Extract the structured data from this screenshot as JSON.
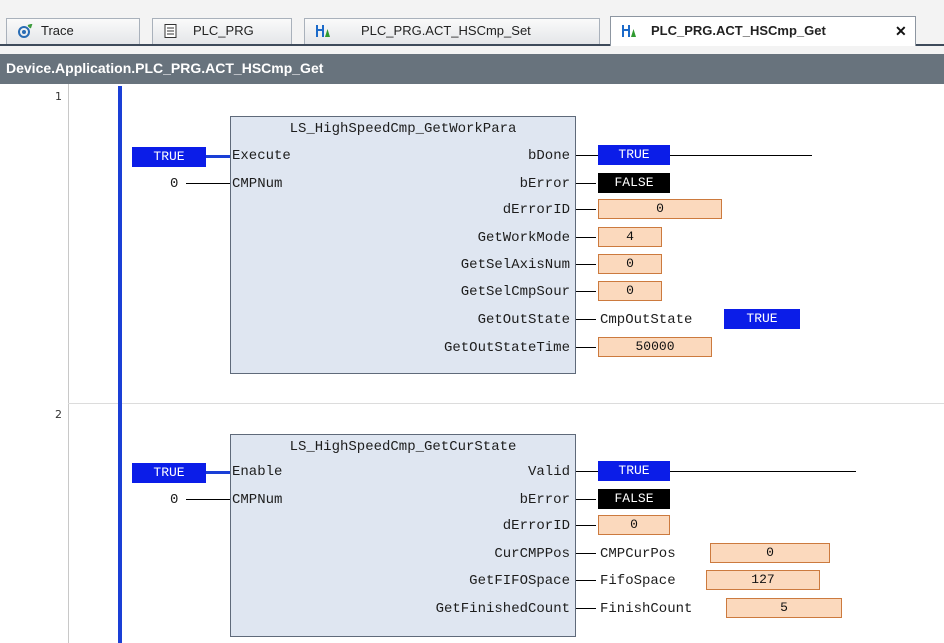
{
  "tabs": [
    {
      "label": "Trace",
      "icon": "trace-icon"
    },
    {
      "label": "PLC_PRG",
      "icon": "document-icon"
    },
    {
      "label": "PLC_PRG.ACT_HSCmp_Set",
      "icon": "ladder-action-icon"
    },
    {
      "label": "PLC_PRG.ACT_HSCmp_Get",
      "icon": "ladder-action-icon",
      "active": true,
      "close": "✕"
    }
  ],
  "path": "Device.Application.PLC_PRG.ACT_HSCmp_Get",
  "networks": [
    {
      "number": "1",
      "block": {
        "title": "LS_HighSpeedCmp_GetWorkPara",
        "inputs": [
          {
            "name": "Execute",
            "value": "TRUE"
          },
          {
            "name": "CMPNum",
            "value": "0"
          }
        ],
        "outputs": [
          {
            "name": "bDone",
            "value": "TRUE"
          },
          {
            "name": "bError",
            "value": "FALSE"
          },
          {
            "name": "dErrorID",
            "value": "0"
          },
          {
            "name": "GetWorkMode",
            "value": "4"
          },
          {
            "name": "GetSelAxisNum",
            "value": "0"
          },
          {
            "name": "GetSelCmpSour",
            "value": "0"
          },
          {
            "name": "GetOutState",
            "var": "CmpOutState",
            "value": "TRUE"
          },
          {
            "name": "GetOutStateTime",
            "value": "50000"
          }
        ]
      }
    },
    {
      "number": "2",
      "block": {
        "title": "LS_HighSpeedCmp_GetCurState",
        "inputs": [
          {
            "name": "Enable",
            "value": "TRUE"
          },
          {
            "name": "CMPNum",
            "value": "0"
          }
        ],
        "outputs": [
          {
            "name": "Valid",
            "value": "TRUE"
          },
          {
            "name": "bError",
            "value": "FALSE"
          },
          {
            "name": "dErrorID",
            "value": "0"
          },
          {
            "name": "CurCMPPos",
            "var": "CMPCurPos",
            "value": "0"
          },
          {
            "name": "GetFIFOSpace",
            "var": "FifoSpace",
            "value": "127"
          },
          {
            "name": "GetFinishedCount",
            "var": "FinishCount",
            "value": "5"
          }
        ]
      }
    }
  ],
  "colors": {
    "true_bg": "#0b1de8",
    "false_bg": "#000000",
    "value_bg": "#fbd9bd",
    "block_bg": "#dfe6f1",
    "rail": "#1a3fd6",
    "path_bar": "#68737d"
  }
}
